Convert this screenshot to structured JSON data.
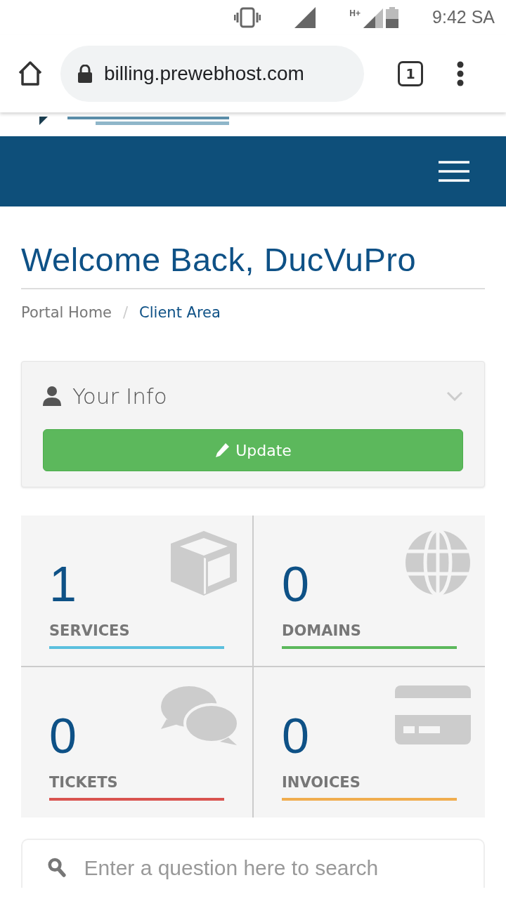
{
  "status_bar": {
    "time": "9:42 SA",
    "network": "H+"
  },
  "browser": {
    "url": "billing.prewebhost.com",
    "tab_count": "1"
  },
  "heading": "Welcome Back, DucVuPro",
  "breadcrumb_separator": "/",
  "breadcrumb": [
    {
      "label": "Portal Home",
      "selected": false
    },
    {
      "label": "Client Area",
      "selected": true
    }
  ],
  "info_panel": {
    "title": "Your Info",
    "expanded": false,
    "button": "Update"
  },
  "stats": [
    {
      "kind": "services",
      "count": "1",
      "label": "SERVICES",
      "color": "#5bc0de"
    },
    {
      "kind": "domains",
      "count": "0",
      "label": "DOMAINS",
      "color": "#5cb85c"
    },
    {
      "kind": "tickets",
      "count": "0",
      "label": "TICKETS",
      "color": "#d9534f"
    },
    {
      "kind": "invoices",
      "count": "0",
      "label": "INVOICES",
      "color": "#f0ad4e"
    }
  ],
  "search": {
    "placeholder": "Enter a question here to search"
  }
}
